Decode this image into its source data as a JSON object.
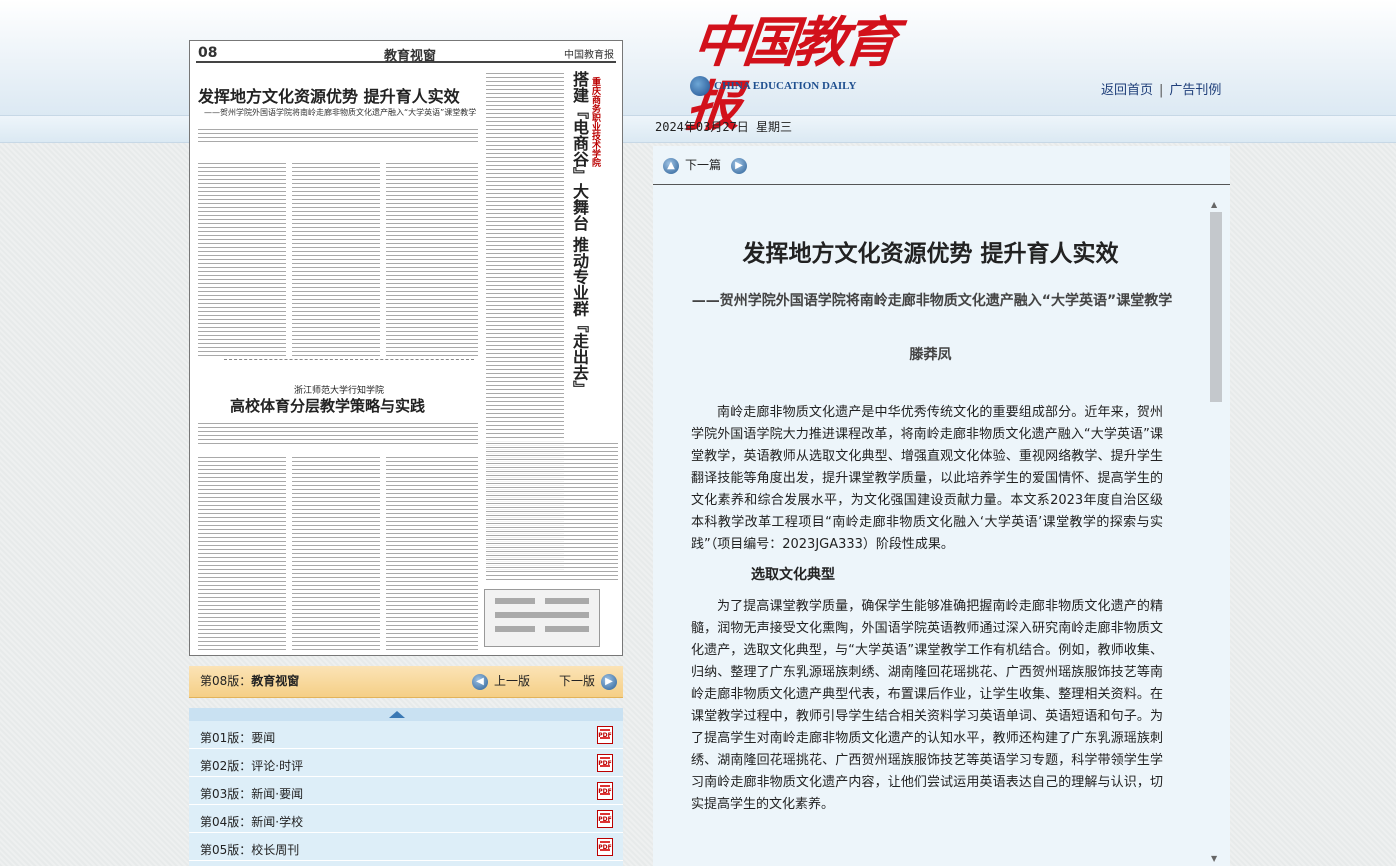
{
  "header": {
    "logo_cn": "中国教育报",
    "logo_en": "CHINA EDUCATION DAILY",
    "links": [
      "返回首页",
      "广告刊例"
    ],
    "link_separator": "|",
    "date": "2024年03月27日  星期三"
  },
  "paper": {
    "page_num": "08",
    "section": "教育视窗",
    "masthead": "中国教育报",
    "headline1": "发挥地方文化资源优势  提升育人实效",
    "subhead1": "——贺州学院外国语学院将南岭走廊非物质文化遗产融入“大学英语”课堂教学",
    "vertical_title": "搭建『电商谷』大舞台  推动专业群『走出去』",
    "vertical_sub": "重庆商务职业技术学院",
    "kicker2": "浙江师范大学行知学院",
    "headline2": "高校体育分层教学策略与实践"
  },
  "edition_bar": {
    "current_label": "第08版：",
    "current_name": "教育视窗",
    "prev": "上一版",
    "next": "下一版"
  },
  "editions": [
    {
      "label": "第01版：要闻"
    },
    {
      "label": "第02版：评论·时评"
    },
    {
      "label": "第03版：新闻·要闻"
    },
    {
      "label": "第04版：新闻·学校"
    },
    {
      "label": "第05版：校长周刊"
    }
  ],
  "article": {
    "next_label": "下一篇",
    "title": "发挥地方文化资源优势  提升育人实效",
    "subtitle": "——贺州学院外国语学院将南岭走廊非物质文化遗产融入“大学英语”课堂教学",
    "author": "滕莽凤",
    "para1": "南岭走廊非物质文化遗产是中华优秀传统文化的重要组成部分。近年来，贺州学院外国语学院大力推进课程改革，将南岭走廊非物质文化遗产融入“大学英语”课堂教学，英语教师从选取文化典型、增强直观文化体验、重视网络教学、提升学生翻译技能等角度出发，提升课堂教学质量，以此培养学生的爱国情怀、提高学生的文化素养和综合发展水平，为文化强国建设贡献力量。本文系2023年度自治区级本科教学改革工程项目“南岭走廊非物质文化融入‘大学英语’课堂教学的探索与实践”（项目编号：2023JGA333）阶段性成果。",
    "section1": "选取文化典型",
    "para2": "为了提高课堂教学质量，确保学生能够准确把握南岭走廊非物质文化遗产的精髓，润物无声接受文化熏陶，外国语学院英语教师通过深入研究南岭走廊非物质文化遗产，选取文化典型，与“大学英语”课堂教学工作有机结合。例如，教师收集、归纳、整理了广东乳源瑶族刺绣、湖南隆回花瑶挑花、广西贺州瑶族服饰技艺等南岭走廊非物质文化遗产典型代表，布置课后作业，让学生收集、整理相关资料。在课堂教学过程中，教师引导学生结合相关资料学习英语单词、英语短语和句子。为了提高学生对南岭走廊非物质文化遗产的认知水平，教师还构建了广东乳源瑶族刺绣、湖南隆回花瑶挑花、广西贺州瑶族服饰技艺等英语学习专题，科学带领学生学习南岭走廊非物质文化遗产内容，让他们尝试运用英语表达自己的理解与认识，切实提高学生的文化素养。"
  },
  "colors": {
    "logo_red": "#d2111b",
    "link_blue": "#1f3f7a",
    "edition_bar": "#f5cf86",
    "list_bg": "#ddeef8",
    "article_bg": "#edf5fa"
  }
}
